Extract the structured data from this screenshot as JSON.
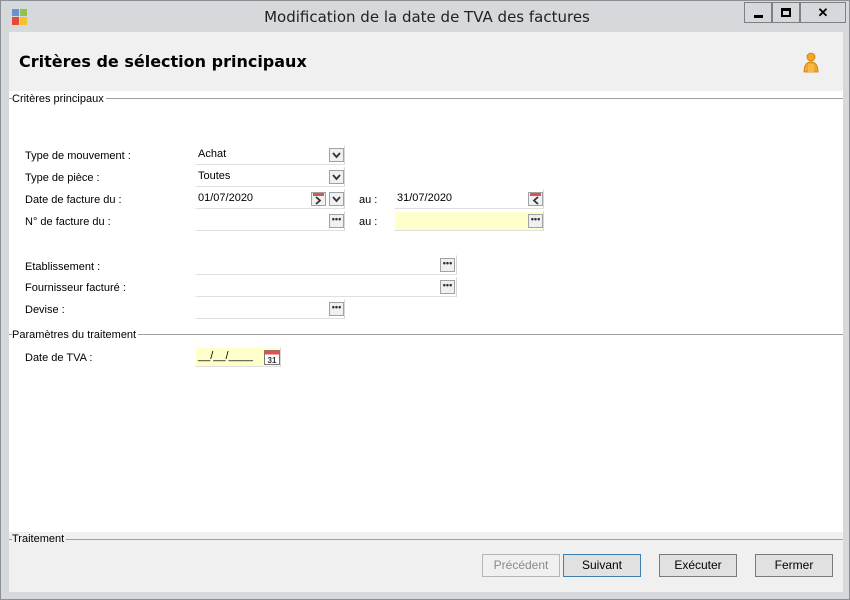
{
  "window": {
    "title": "Modification de la date de TVA des factures",
    "minimize_glyph": "▁",
    "maximize_glyph": "□",
    "close_glyph": "✕"
  },
  "header": {
    "title": "Critères de sélection principaux",
    "user_icon": "person-icon"
  },
  "sections": {
    "main": "Critères principaux",
    "params": "Paramètres du traitement",
    "treatment": "Traitement"
  },
  "form": {
    "type_mouvement": {
      "label": "Type de mouvement :",
      "value": "Achat"
    },
    "type_piece": {
      "label": "Type de pièce :",
      "value": "Toutes"
    },
    "date_facture": {
      "label": "Date de facture du :",
      "from": "01/07/2020",
      "au_label": "au :",
      "to": "31/07/2020"
    },
    "num_facture": {
      "label": "N° de facture du :",
      "from": "",
      "au_label": "au :",
      "to": ""
    },
    "etablissement": {
      "label": "Etablissement :",
      "value": ""
    },
    "fournisseur": {
      "label": "Fournisseur facturé :",
      "value": ""
    },
    "devise": {
      "label": "Devise :",
      "value": ""
    },
    "date_tva": {
      "label": "Date de TVA :",
      "value": "__/__/____"
    }
  },
  "buttons": {
    "precedent": "Précédent",
    "suivant": "Suivant",
    "executer": "Exécuter",
    "fermer": "Fermer"
  },
  "colors": {
    "required_field": "#ffffcc",
    "header_bg": "#f0f0f0",
    "window_frame": "#d6d9dc"
  }
}
